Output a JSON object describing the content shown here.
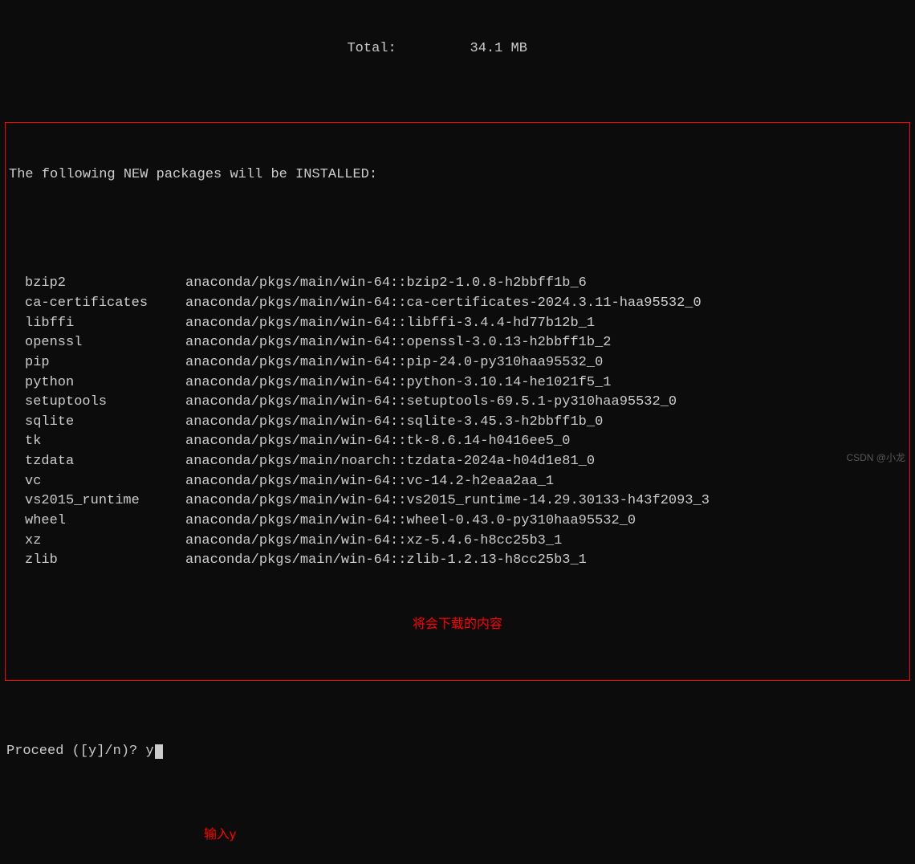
{
  "total": {
    "label": "Total:",
    "value": "34.1 MB"
  },
  "install_header": "The following NEW packages will be INSTALLED:",
  "packages": [
    {
      "name": "bzip2",
      "spec": "anaconda/pkgs/main/win-64::bzip2-1.0.8-h2bbff1b_6"
    },
    {
      "name": "ca-certificates",
      "spec": "anaconda/pkgs/main/win-64::ca-certificates-2024.3.11-haa95532_0"
    },
    {
      "name": "libffi",
      "spec": "anaconda/pkgs/main/win-64::libffi-3.4.4-hd77b12b_1"
    },
    {
      "name": "openssl",
      "spec": "anaconda/pkgs/main/win-64::openssl-3.0.13-h2bbff1b_2"
    },
    {
      "name": "pip",
      "spec": "anaconda/pkgs/main/win-64::pip-24.0-py310haa95532_0"
    },
    {
      "name": "python",
      "spec": "anaconda/pkgs/main/win-64::python-3.10.14-he1021f5_1"
    },
    {
      "name": "setuptools",
      "spec": "anaconda/pkgs/main/win-64::setuptools-69.5.1-py310haa95532_0"
    },
    {
      "name": "sqlite",
      "spec": "anaconda/pkgs/main/win-64::sqlite-3.45.3-h2bbff1b_0"
    },
    {
      "name": "tk",
      "spec": "anaconda/pkgs/main/win-64::tk-8.6.14-h0416ee5_0"
    },
    {
      "name": "tzdata",
      "spec": "anaconda/pkgs/main/noarch::tzdata-2024a-h04d1e81_0"
    },
    {
      "name": "vc",
      "spec": "anaconda/pkgs/main/win-64::vc-14.2-h2eaa2aa_1"
    },
    {
      "name": "vs2015_runtime",
      "spec": "anaconda/pkgs/main/win-64::vs2015_runtime-14.29.30133-h43f2093_3"
    },
    {
      "name": "wheel",
      "spec": "anaconda/pkgs/main/win-64::wheel-0.43.0-py310haa95532_0"
    },
    {
      "name": "xz",
      "spec": "anaconda/pkgs/main/win-64::xz-5.4.6-h8cc25b3_1"
    },
    {
      "name": "zlib",
      "spec": "anaconda/pkgs/main/win-64::zlib-1.2.13-h8cc25b3_1"
    }
  ],
  "annotation_download": "将会下载的内容",
  "prompt": {
    "text": "Proceed ([y]/n)? ",
    "input": "y"
  },
  "annotation_input": "输入y",
  "watermark": "CSDN @小龙"
}
